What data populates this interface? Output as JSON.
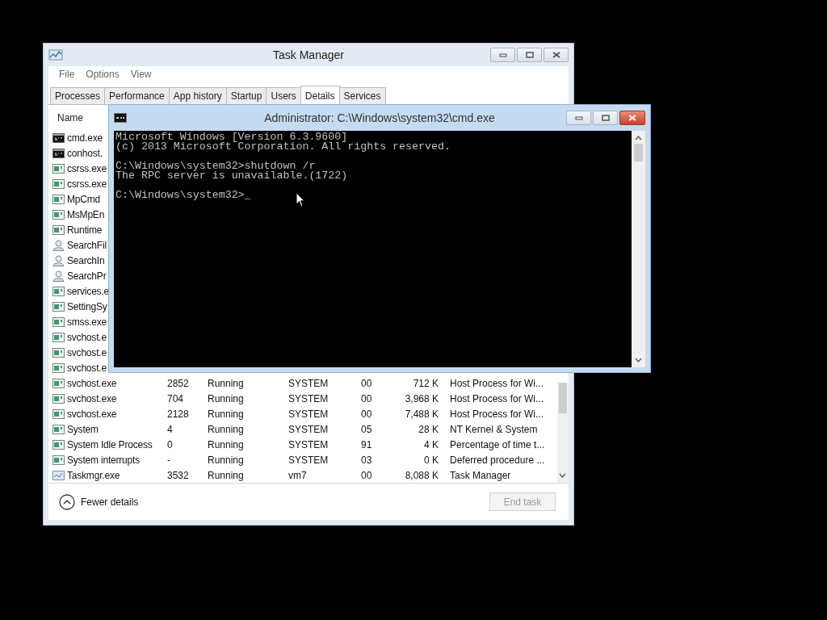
{
  "task_manager": {
    "title": "Task Manager",
    "menu": [
      "File",
      "Options",
      "View"
    ],
    "tabs": [
      {
        "label": "Processes",
        "selected": false
      },
      {
        "label": "Performance",
        "selected": false
      },
      {
        "label": "App history",
        "selected": false
      },
      {
        "label": "Startup",
        "selected": false
      },
      {
        "label": "Users",
        "selected": false
      },
      {
        "label": "Details",
        "selected": true
      },
      {
        "label": "Services",
        "selected": false
      }
    ],
    "columns": [
      "Name"
    ],
    "rows": [
      {
        "kind": "console",
        "name": "cmd.exe"
      },
      {
        "kind": "console",
        "name": "conhost."
      },
      {
        "kind": "app",
        "name": "csrss.exe"
      },
      {
        "kind": "app",
        "name": "csrss.exe"
      },
      {
        "kind": "app",
        "name": "MpCmd"
      },
      {
        "kind": "app",
        "name": "MsMpEn"
      },
      {
        "kind": "app",
        "name": "Runtime"
      },
      {
        "kind": "search",
        "name": "SearchFil"
      },
      {
        "kind": "search",
        "name": "SearchIn"
      },
      {
        "kind": "search",
        "name": "SearchPr"
      },
      {
        "kind": "app",
        "name": "services.e"
      },
      {
        "kind": "app",
        "name": "SettingSy"
      },
      {
        "kind": "app",
        "name": "smss.exe"
      },
      {
        "kind": "app",
        "name": "svchost.e"
      },
      {
        "kind": "app",
        "name": "svchost.e"
      },
      {
        "kind": "app",
        "name": "svchost.e"
      },
      {
        "kind": "app",
        "name": "svchost.exe",
        "pid": "2852",
        "status": "Running",
        "user": "SYSTEM",
        "cpu": "00",
        "memory": "712 K",
        "description": "Host Process for Wi..."
      },
      {
        "kind": "app",
        "name": "svchost.exe",
        "pid": "704",
        "status": "Running",
        "user": "SYSTEM",
        "cpu": "00",
        "memory": "3,968 K",
        "description": "Host Process for Wi..."
      },
      {
        "kind": "app",
        "name": "svchost.exe",
        "pid": "2128",
        "status": "Running",
        "user": "SYSTEM",
        "cpu": "00",
        "memory": "7,488 K",
        "description": "Host Process for Wi..."
      },
      {
        "kind": "app",
        "name": "System",
        "pid": "4",
        "status": "Running",
        "user": "SYSTEM",
        "cpu": "05",
        "memory": "28 K",
        "description": "NT Kernel & System"
      },
      {
        "kind": "app",
        "name": "System Idle Process",
        "pid": "0",
        "status": "Running",
        "user": "SYSTEM",
        "cpu": "91",
        "memory": "4 K",
        "description": "Percentage of time t..."
      },
      {
        "kind": "app",
        "name": "System interrupts",
        "pid": "-",
        "status": "Running",
        "user": "SYSTEM",
        "cpu": "03",
        "memory": "0 K",
        "description": "Deferred procedure ..."
      },
      {
        "kind": "chart",
        "name": "Taskmgr.exe",
        "pid": "3532",
        "status": "Running",
        "user": "vm7",
        "cpu": "00",
        "memory": "8,088 K",
        "description": "Task Manager"
      }
    ],
    "fewer_details": "Fewer details",
    "end_task": {
      "label": "End task",
      "disabled": true
    }
  },
  "console": {
    "title": "Administrator: C:\\Windows\\system32\\cmd.exe",
    "blocks": [
      [
        "Microsoft Windows [Version 6.3.9600]",
        "(c) 2013 Microsoft Corporation. All rights reserved."
      ],
      [
        "C:\\Windows\\system32>shutdown /r",
        "The RPC server is unavailable.(1722)"
      ],
      [
        "C:\\Windows\\system32>"
      ]
    ],
    "cursor": "_"
  }
}
